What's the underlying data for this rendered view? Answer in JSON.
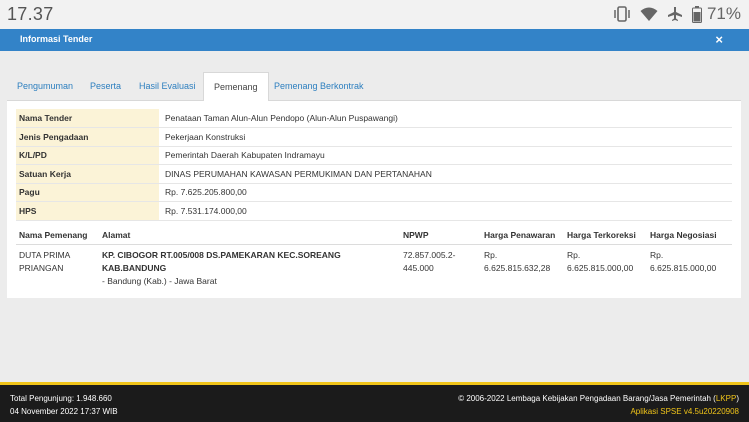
{
  "status_bar": {
    "time": "17.37",
    "battery_text": "71%",
    "icons": [
      "vibrate-icon",
      "wifi-icon",
      "airplane-icon",
      "battery-icon"
    ]
  },
  "modal": {
    "title": "Informasi Tender",
    "close_icon": "×"
  },
  "tabs": [
    {
      "label": "Pengumuman",
      "active": false
    },
    {
      "label": "Peserta",
      "active": false
    },
    {
      "label": "Hasil Evaluasi",
      "active": false
    },
    {
      "label": "Pemenang",
      "active": true
    },
    {
      "label": "Pemenang Berkontrak",
      "active": false
    }
  ],
  "info": [
    {
      "label": "Nama Tender",
      "value": "Penataan Taman Alun-Alun Pendopo (Alun-Alun Puspawangi)"
    },
    {
      "label": "Jenis Pengadaan",
      "value": "Pekerjaan Konstruksi"
    },
    {
      "label": "K/L/PD",
      "value": "Pemerintah Daerah Kabupaten Indramayu"
    },
    {
      "label": "Satuan Kerja",
      "value": "DINAS PERUMAHAN KAWASAN PERMUKIMAN DAN PERTANAHAN"
    },
    {
      "label": "Pagu",
      "value": "Rp. 7.625.205.800,00"
    },
    {
      "label": "HPS",
      "value": "Rp. 7.531.174.000,00"
    }
  ],
  "winner_table": {
    "headers": [
      "Nama Pemenang",
      "Alamat",
      "NPWP",
      "Harga Penawaran",
      "Harga Terkoreksi",
      "Harga Negosiasi"
    ],
    "rows": [
      {
        "name": "DUTA PRIMA PRIANGAN",
        "address_bold": "KP. CIBOGOR RT.005/008 DS.PAMEKARAN KEC.SOREANG KAB.BANDUNG",
        "address_rest": "- Bandung (Kab.) - Jawa Barat",
        "npwp": "72.857.005.2-445.000",
        "harga_penawaran": "Rp. 6.625.815.632,28",
        "harga_terkoreksi": "Rp. 6.625.815.000,00",
        "harga_negosiasi": "Rp. 6.625.815.000,00"
      }
    ]
  },
  "footer": {
    "visitors": "Total Pengunjung: 1.948.660",
    "datetime": "04 November 2022 17:37 WIB",
    "copyright_prefix": "© 2006-2022 Lembaga Kebijakan Pengadaan Barang/Jasa Pemerintah (",
    "copyright_link": "LKPP",
    "copyright_suffix": ")",
    "app_version": "Aplikasi SPSE v4.5u20220908"
  },
  "colors": {
    "header_blue": "#3383c8",
    "tab_link": "#2d7fbf",
    "label_bg": "#fbf3d7",
    "footer_bg": "#1b1b1b",
    "footer_accent": "#f0c419"
  }
}
